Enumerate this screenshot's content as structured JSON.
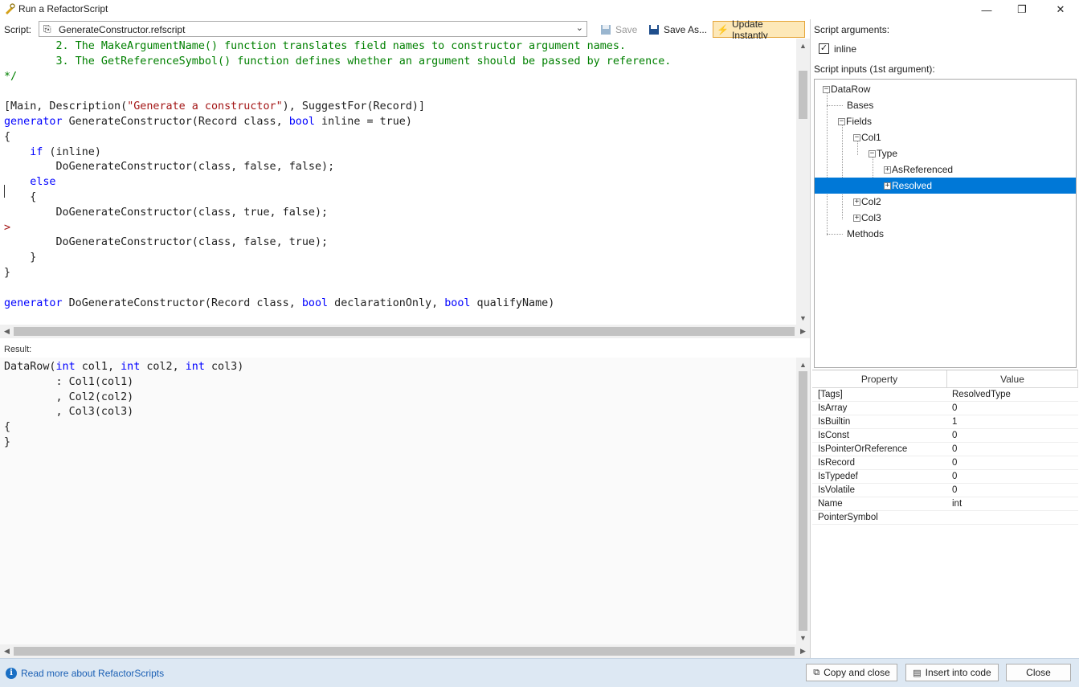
{
  "window": {
    "title": "Run a RefactorScript",
    "minimize_glyph": "—",
    "restore_glyph": "❐",
    "close_glyph": "✕"
  },
  "toolbar": {
    "script_label": "Script:",
    "script_file": "GenerateConstructor.refscript",
    "save_label": "Save",
    "save_as_label": "Save As...",
    "update_label": "Update Instantly"
  },
  "code": {
    "lines": [
      "        2. The MakeArgumentName() function translates field names to constructor argument names.",
      "        3. The GetReferenceSymbol() function defines whether an argument should be passed by reference.",
      "*/",
      "",
      "[Main, Description(\"Generate a constructor\"), SuggestFor(Record)]",
      "generator GenerateConstructor(Record class, bool inline = true)",
      "{",
      "    if (inline)",
      "        DoGenerateConstructor(class, false, false);",
      "    else",
      "    {",
      "        DoGenerateConstructor(class, true, false);",
      ">",
      "        DoGenerateConstructor(class, false, true);",
      "    }",
      "}",
      "",
      "generator DoGenerateConstructor(Record class, bool declarationOnly, bool qualifyName)"
    ]
  },
  "result": {
    "label": "Result:",
    "lines": [
      "DataRow(int col1, int col2, int col3)",
      "        : Col1(col1)",
      "        , Col2(col2)",
      "        , Col3(col3)",
      "{",
      "}"
    ]
  },
  "args": {
    "label": "Script arguments:",
    "inline_label": "inline",
    "inline_checked": true
  },
  "inputs": {
    "label": "Script inputs (1st argument):",
    "tree": [
      {
        "label": "DataRow",
        "expander": "−"
      },
      {
        "label": "Bases",
        "expander": ""
      },
      {
        "label": "Fields",
        "expander": "−"
      },
      {
        "label": "Col1",
        "expander": "−"
      },
      {
        "label": "Type",
        "expander": "−"
      },
      {
        "label": "AsReferenced",
        "expander": "+"
      },
      {
        "label": "Resolved",
        "expander": "+",
        "selected": true
      },
      {
        "label": "Col2",
        "expander": "+"
      },
      {
        "label": "Col3",
        "expander": "+"
      },
      {
        "label": "Methods",
        "expander": ""
      }
    ]
  },
  "properties": {
    "col_property": "Property",
    "col_value": "Value",
    "rows": [
      {
        "name": "[Tags]",
        "value": "ResolvedType"
      },
      {
        "name": "IsArray",
        "value": "0"
      },
      {
        "name": "IsBuiltin",
        "value": "1"
      },
      {
        "name": "IsConst",
        "value": "0"
      },
      {
        "name": "IsPointerOrReference",
        "value": "0"
      },
      {
        "name": "IsRecord",
        "value": "0"
      },
      {
        "name": "IsTypedef",
        "value": "0"
      },
      {
        "name": "IsVolatile",
        "value": "0"
      },
      {
        "name": "Name",
        "value": "int"
      },
      {
        "name": "PointerSymbol",
        "value": ""
      }
    ]
  },
  "footer": {
    "read_more": "Read more about RefactorScripts",
    "copy_close": "Copy and close",
    "insert_code": "Insert into code",
    "close": "Close"
  },
  "colors": {
    "keyword": "#0000ff",
    "comment": "#008000",
    "string": "#a31515",
    "selection": "#0078d7",
    "update_bg": "#fde8b8"
  },
  "icons": [
    "app-icon",
    "file-script-icon",
    "save-icon",
    "save-as-icon",
    "lightning-icon",
    "info-icon",
    "copy-icon",
    "insert-icon"
  ]
}
